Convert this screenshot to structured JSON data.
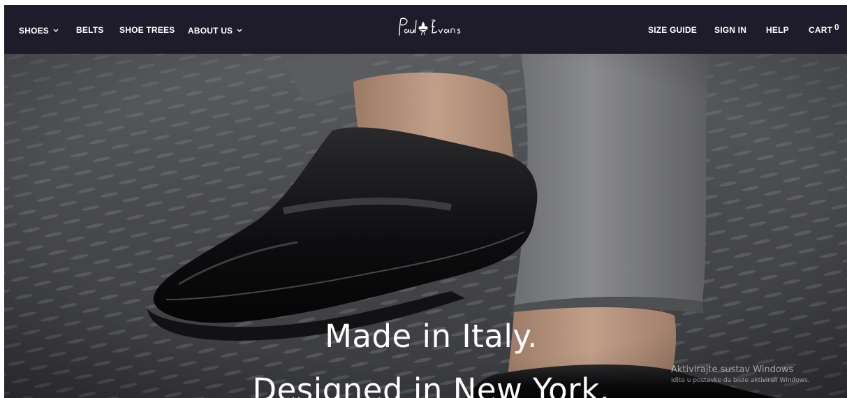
{
  "nav": {
    "left": [
      {
        "label": "SHOES",
        "dropdown": true
      },
      {
        "label": "BELTS",
        "dropdown": false
      },
      {
        "label": "SHOE TREES",
        "dropdown": false
      },
      {
        "label": "ABOUT US",
        "dropdown": true
      }
    ],
    "logo_text": "Paul Evans",
    "right": [
      {
        "label": "SIZE GUIDE"
      },
      {
        "label": "SIGN IN"
      },
      {
        "label": "HELP"
      },
      {
        "label": "CART"
      }
    ],
    "cart_count": "0"
  },
  "hero": {
    "line1": "Made in Italy.",
    "line2": "Designed in New York."
  },
  "windows_watermark": {
    "title": "Aktivirajte sustav Windows",
    "subtitle": "Idite u postavke da biste aktivirali Windows."
  },
  "colors": {
    "navbar_bg": "#1e1c2b",
    "nav_text": "#ffffff",
    "hero_overlay_text": "#ffffff"
  }
}
